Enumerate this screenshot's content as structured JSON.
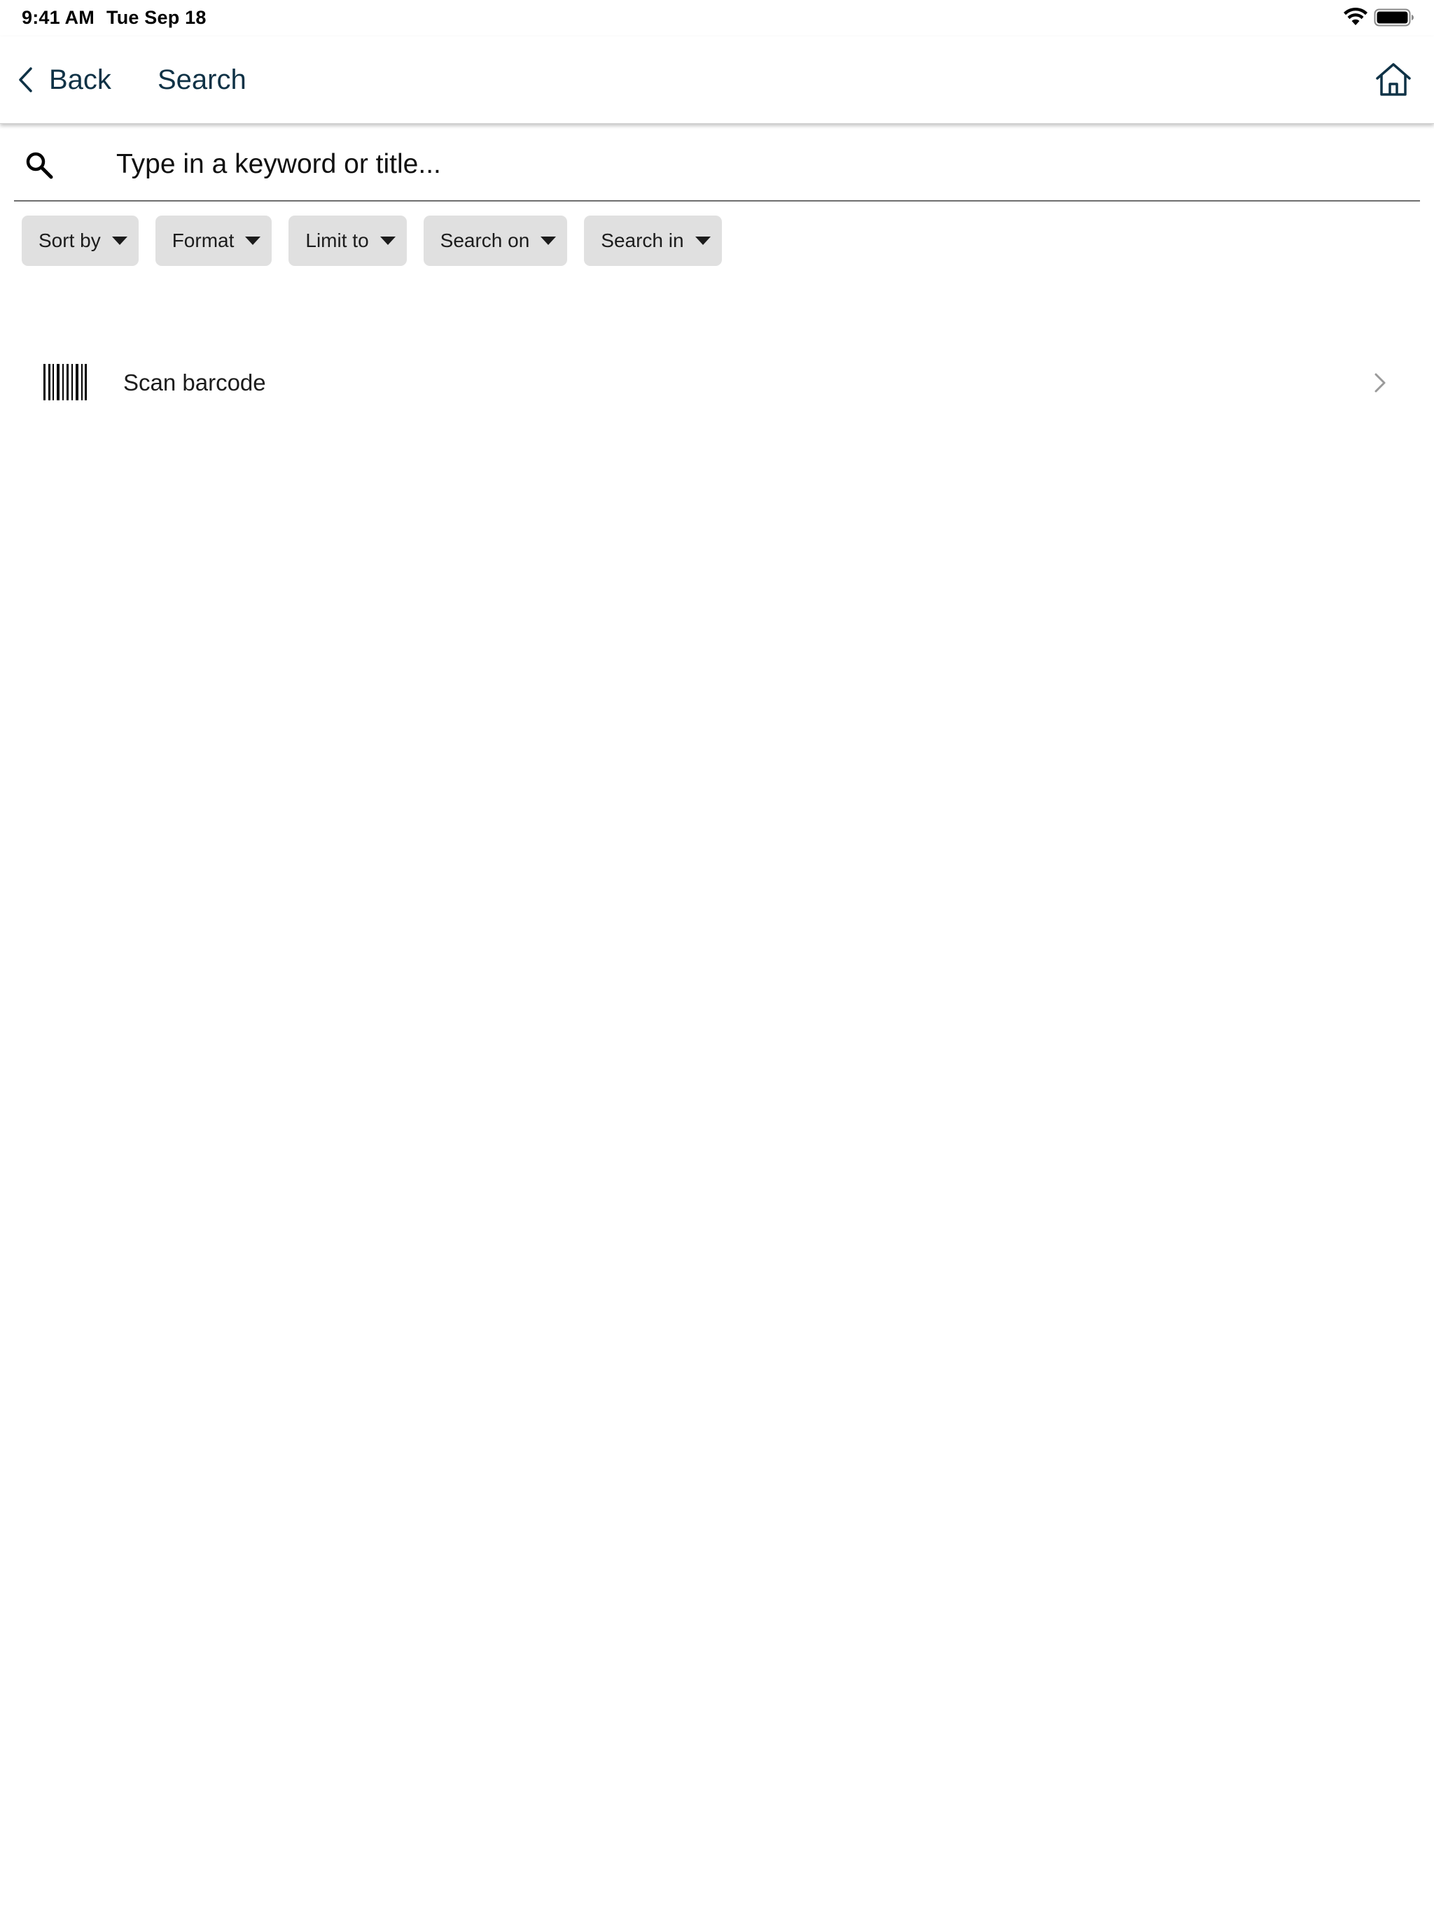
{
  "status_bar": {
    "time": "9:41 AM",
    "date": "Tue Sep 18",
    "icons": [
      "wifi-icon",
      "battery-icon"
    ]
  },
  "nav": {
    "back_label": "Back",
    "title": "Search",
    "home_icon": "home-icon",
    "color": "#0f3246"
  },
  "search": {
    "placeholder": "Type in a keyword or title...",
    "value": "",
    "icon": "search-icon"
  },
  "filters": [
    {
      "label": "Sort by"
    },
    {
      "label": "Format"
    },
    {
      "label": "Limit to"
    },
    {
      "label": "Search on"
    },
    {
      "label": "Search in"
    }
  ],
  "scan": {
    "label": "Scan barcode",
    "icon": "barcode-icon"
  }
}
